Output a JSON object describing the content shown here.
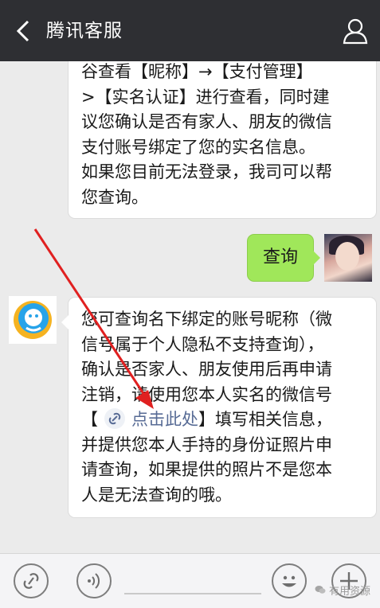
{
  "header": {
    "title": "腾讯客服"
  },
  "messages": {
    "top_text": "谷查看【昵称】→【支付管理】>【实名认证】进行查看，同时建议您确认是否有家人、朋友的微信支付账号绑定了您的实名信息。如果您目前无法登录，我司可以帮您查询。",
    "top_lines": [
      "谷查看【昵称】→【支付管理】",
      ">【实名认证】进行查看，同时建",
      "议您确认是否有家人、朋友的微信",
      "支付账号绑定了您的实名信息。",
      "如果您目前无法登录，我司可以帮",
      "您查询。"
    ],
    "query_text": "查询",
    "main_lines": [
      "您可查询名下绑定的账号昵称（微",
      "信号属于个人隐私不支持查询），",
      "确认是否家人、朋友使用后再申请",
      "注销，请使用您本人实名的微信号"
    ],
    "link_prefix": "【",
    "link_label": "点击此处",
    "link_suffix": "】填写相关信息，",
    "main_lines_after": [
      "并提供您本人手持的身份证照片申",
      "请查询，如果提供的照片不是您本",
      "人是无法查询的哦。"
    ]
  },
  "colors": {
    "topbar": "#2e2f33",
    "sent_bubble": "#a0e75a",
    "link": "#576b95",
    "arrow": "#e02020",
    "service_logo": "#26a3e9"
  },
  "watermark": "有用资源"
}
